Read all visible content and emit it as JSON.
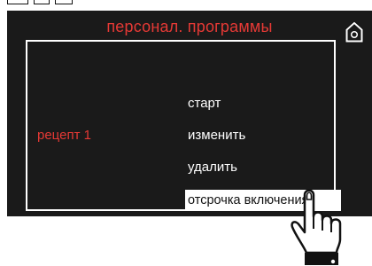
{
  "header": {
    "title": "персонал. программы",
    "home_icon": "home-icon"
  },
  "recipe": {
    "label": "рецепт 1"
  },
  "menu": {
    "items": [
      {
        "label": "старт"
      },
      {
        "label": "изменить"
      },
      {
        "label": "удалить"
      },
      {
        "label": "отсрочка включения",
        "selected": true
      }
    ]
  },
  "pointer_icon": "pointing-hand-icon",
  "colors": {
    "screen_bg": "#1a1a1a",
    "accent_red": "#e53935",
    "text": "#ffffff",
    "highlight_bg": "#ffffff"
  }
}
